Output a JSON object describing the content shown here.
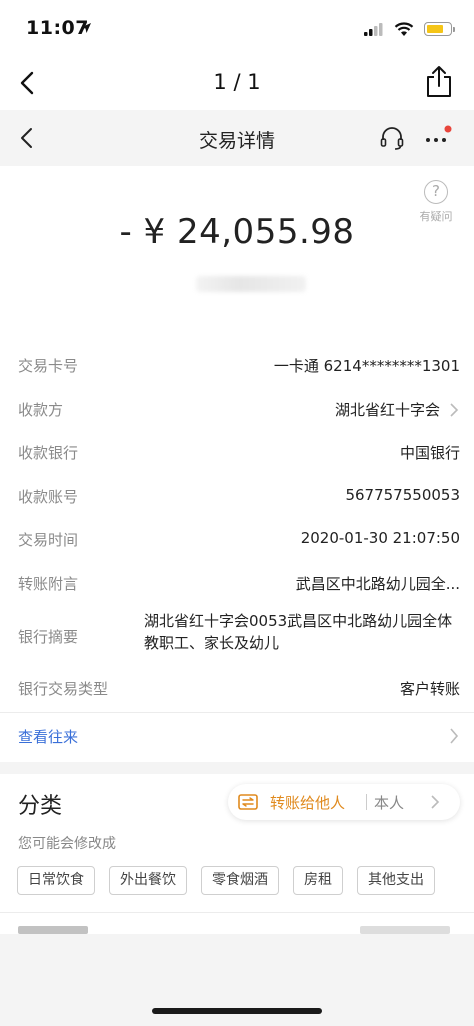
{
  "status_bar": {
    "time": "11:07"
  },
  "nav_outer": {
    "page_counter": "1 / 1"
  },
  "nav_inner": {
    "title": "交易详情"
  },
  "help": {
    "label": "有疑问",
    "glyph": "?"
  },
  "amount": {
    "text": "- ¥  24,055.98"
  },
  "details": [
    {
      "label": "交易卡号",
      "value": "一卡通 6214********1301",
      "arrow": false
    },
    {
      "label": "收款方",
      "value": "湖北省红十字会",
      "arrow": true
    },
    {
      "label": "收款银行",
      "value": "中国银行",
      "arrow": false
    },
    {
      "label": "收款账号",
      "value": "567757550053",
      "arrow": false
    },
    {
      "label": "交易时间",
      "value": "2020-01-30 21:07:50",
      "arrow": false
    },
    {
      "label": "转账附言",
      "value": "武昌区中北路幼儿园全...",
      "arrow": false
    },
    {
      "label": "银行摘要",
      "value": "湖北省红十字会0053武昌区中北路幼儿园全体教职工、家长及幼儿",
      "arrow": false
    },
    {
      "label": "银行交易类型",
      "value": "客户转账",
      "arrow": false
    }
  ],
  "view_history": {
    "label": "查看往来"
  },
  "category": {
    "title": "分类",
    "selected_type": "转账给他人",
    "selected_owner": "本人",
    "hint": "您可能会修改成",
    "tags": [
      "日常饮食",
      "外出餐饮",
      "零食烟酒",
      "房租",
      "其他支出"
    ]
  },
  "colors": {
    "link_blue": "#3a6fd8",
    "accent_orange": "#e08a1e",
    "notification_red": "#e8453c",
    "battery_yellow": "#f5c518"
  }
}
